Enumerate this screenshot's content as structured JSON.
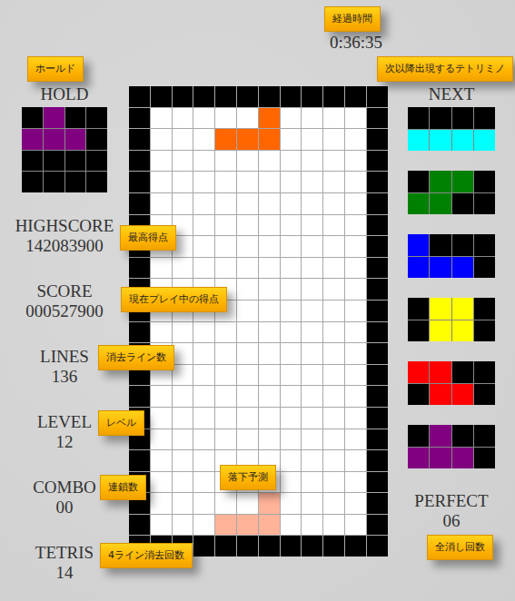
{
  "timer": {
    "annotation": "経過時間",
    "value": "0:36:35"
  },
  "hold": {
    "annotation": "ホールド",
    "title": "HOLD",
    "color": "#800080",
    "rows": [
      ".X..",
      "XXX.",
      "....",
      "...."
    ]
  },
  "next": {
    "annotation": "次以降出現するテトリミノ",
    "title": "NEXT",
    "pieces": [
      {
        "color": "#00ffff",
        "rows": [
          "....",
          "XXXX"
        ]
      },
      {
        "color": "#008000",
        "rows": [
          ".XX.",
          "XX.."
        ]
      },
      {
        "color": "#0000ff",
        "rows": [
          "X...",
          "XXX."
        ]
      },
      {
        "color": "#ffff00",
        "rows": [
          ".XX.",
          ".XX."
        ]
      },
      {
        "color": "#ff0000",
        "rows": [
          "XX..",
          ".XX."
        ]
      },
      {
        "color": "#800080",
        "rows": [
          ".X..",
          "XXX."
        ]
      }
    ]
  },
  "stats": [
    {
      "label": "HIGHSCORE",
      "value": "142083900",
      "annotation": "最高得点"
    },
    {
      "label": "SCORE",
      "value": "000527900",
      "annotation": "現在プレイ中の得点"
    },
    {
      "label": "LINES",
      "value": "136",
      "annotation": "消去ライン数"
    },
    {
      "label": "LEVEL",
      "value": "12",
      "annotation": "レベル"
    },
    {
      "label": "COMBO",
      "value": "00",
      "annotation": "連鎖数"
    },
    {
      "label": "TETRIS",
      "value": "14",
      "annotation": "4ライン消去回数"
    }
  ],
  "perfect": {
    "label": "PERFECT",
    "value": "06",
    "annotation": "全消し回数"
  },
  "board": {
    "active_color": "#ff6600",
    "ghost_color": "#ffb399",
    "ghost_annotation": "落下予測",
    "rows": [
      ".....A....",
      "...AAA....",
      "..........",
      "..........",
      "..........",
      "..........",
      "..........",
      "..........",
      "..........",
      "..........",
      "..........",
      "..........",
      "..........",
      "..........",
      "..........",
      "..........",
      "..........",
      "..........",
      ".....G....",
      "...GGG...."
    ]
  }
}
